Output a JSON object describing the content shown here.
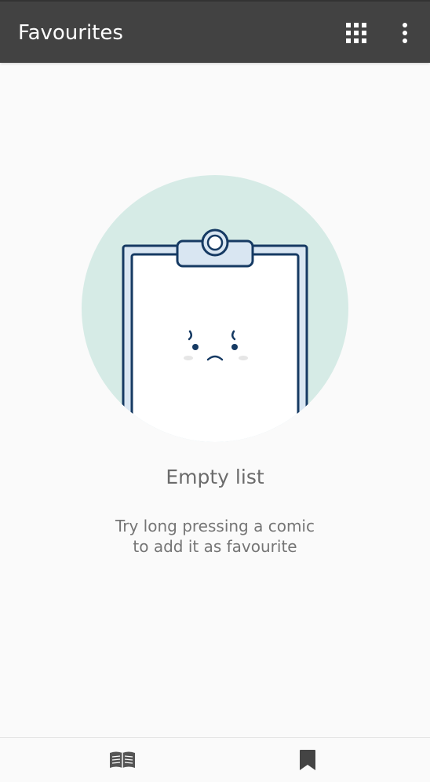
{
  "appbar": {
    "title": "Favourites",
    "grid_icon": "grid-view-icon",
    "more_icon": "more-vertical-icon"
  },
  "empty_state": {
    "title": "Empty list",
    "subtitle_line1": "Try long pressing a comic",
    "subtitle_line2": "to add it as favourite",
    "illustration": "sad-clipboard-icon"
  },
  "bottom_nav": {
    "items": [
      {
        "icon": "open-book-icon",
        "selected": false
      },
      {
        "icon": "bookmark-icon",
        "selected": true
      }
    ]
  },
  "colors": {
    "appbar": "#424242",
    "background": "#fafafa",
    "illustration_circle": "#d6ebe6",
    "illustration_outline": "#163a63",
    "icon": "#555555"
  }
}
